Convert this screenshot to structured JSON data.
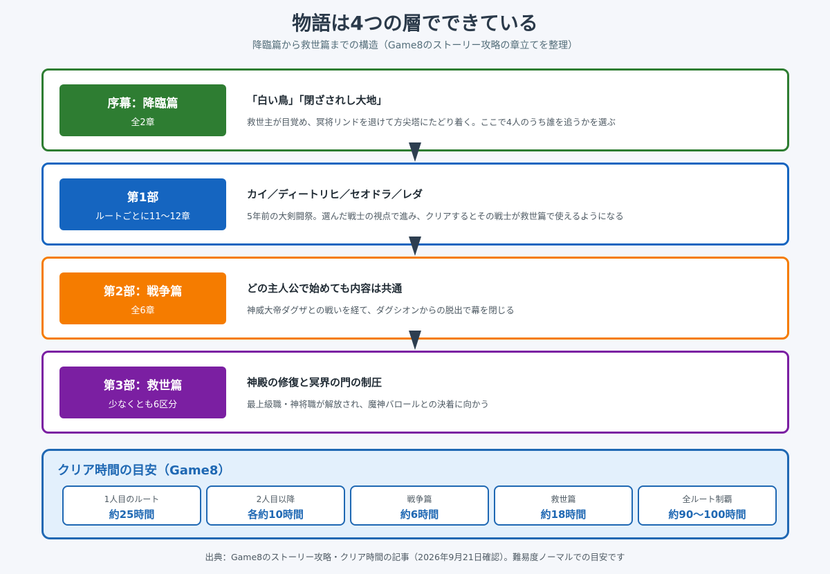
{
  "header": {
    "title": "物語は4つの層でできている",
    "subtitle": "降臨篇から救世篇までの構造（Game8のストーリー攻略の章立てを整理）"
  },
  "layers": [
    {
      "name": "序幕：降臨篇",
      "count": "全2章",
      "heading": "「白い鳥」「閉ざされし大地」",
      "description": "救世主が目覚め、冥将リンドを退けて方尖塔にたどり着く。ここで4人のうち誰を追うかを選ぶ",
      "color": "#2e7d32"
    },
    {
      "name": "第1部",
      "count": "ルートごとに11〜12章",
      "heading": "カイ／ディートリヒ／セオドラ／レダ",
      "description": "5年前の大剣闘祭。選んだ戦士の視点で進み、クリアするとその戦士が救世篇で使えるようになる",
      "color": "#1565c0"
    },
    {
      "name": "第2部：戦争篇",
      "count": "全6章",
      "heading": "どの主人公で始めても内容は共通",
      "description": "神威大帝ダグザとの戦いを経て、ダグシオンからの脱出で幕を閉じる",
      "color": "#f57c00"
    },
    {
      "name": "第3部：救世篇",
      "count": "少なくとも6区分",
      "heading": "神殿の修復と冥界の門の制圧",
      "description": "最上級職・神将職が解放され、魔神バロールとの決着に向かう",
      "color": "#7b1fa2"
    }
  ],
  "clear_time": {
    "title": "クリア時間の目安（Game8）",
    "items": [
      {
        "label": "1人目のルート",
        "value": "約25時間"
      },
      {
        "label": "2人目以降",
        "value": "各約10時間"
      },
      {
        "label": "戦争篇",
        "value": "約6時間"
      },
      {
        "label": "救世篇",
        "value": "約18時間"
      },
      {
        "label": "全ルート制覇",
        "value": "約90〜100時間"
      }
    ]
  },
  "source": "出典：Game8のストーリー攻略・クリア時間の記事（2026年9月21日確認）。難易度ノーマルでの目安です",
  "colors": {
    "arrow": "#2d3e50",
    "accent_blue": "#1f68b3"
  }
}
